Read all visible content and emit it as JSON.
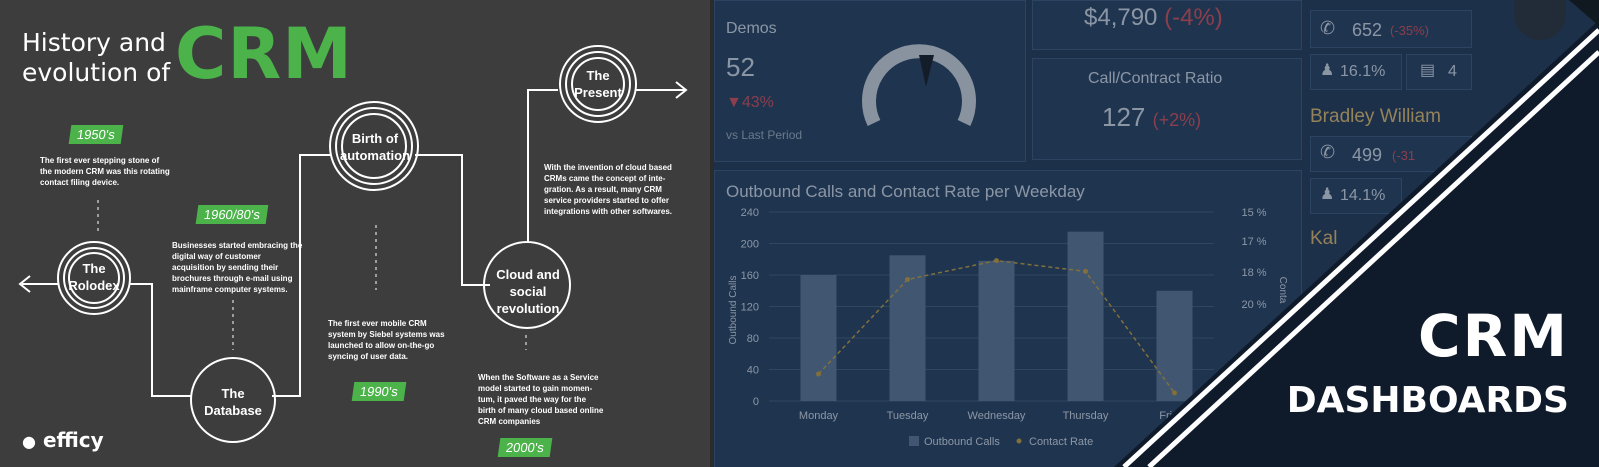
{
  "left": {
    "title_line1": "History and",
    "title_line2": "evolution of",
    "title_big": "CRM",
    "brand": "efficy",
    "eras": [
      {
        "tag": "1950's",
        "note": "The first ever stepping stone of the modern CRM was this rotating contact filing device.",
        "circle": "The Rolodex"
      },
      {
        "tag": "1960/80's",
        "note": "Businesses started embracing the digital way of customer acquisition by sending their brochures through e-mail using mainframe computer systems.",
        "circle": "The Database"
      },
      {
        "tag": "1990's",
        "note": "The first ever mobile CRM system by Siebel systems was launched to allow on-the-go syncing of user data.",
        "circle": "Birth of automation"
      },
      {
        "tag": "2000's",
        "note": "When the Software as a Service model started to gain momen-tum, it paved the way for the birth of many cloud based online CRM companies",
        "circle": "Cloud and social revolution"
      },
      {
        "tag": "",
        "note": "With the invention of cloud based CRMs came the concept of inte-gration. As a result, many CRM service providers started to offer integrations with other softwares.",
        "circle": "The Present"
      }
    ]
  },
  "right": {
    "demos_label": "Demos",
    "demos_value": "52",
    "demos_change": "▼43%",
    "vs_last": "vs Last Period",
    "revenue": "$4,790",
    "revenue_change": "(-4%)",
    "ratio_label": "Call/Contract Ratio",
    "ratio_value": "127",
    "ratio_change": "(+2%)",
    "agent1_calls": "652",
    "agent1_change": "(-35%)",
    "agent1_rate": "16.1%",
    "agent1_count": "4",
    "agent2_name": "Bradley William",
    "agent2_calls": "499",
    "agent2_change": "(-31",
    "agent2_rate": "14.1%",
    "agent3_name": "Kal",
    "overlay_title1": "CRM",
    "overlay_title2": "DASHBOARDS",
    "accent_green": "#4bb34a",
    "accent_red": "#c84a55"
  },
  "chart_data": {
    "type": "bar",
    "title": "Outbound Calls and Contact Rate per Weekday",
    "categories": [
      "Monday",
      "Tuesday",
      "Wednesday",
      "Thursday",
      "Friday"
    ],
    "series": [
      {
        "name": "Outbound Calls",
        "type": "bar",
        "values": [
          160,
          185,
          178,
          215,
          140
        ]
      },
      {
        "name": "Contact Rate",
        "type": "line",
        "values": [
          14.0,
          17.5,
          18.2,
          17.8,
          13.3
        ]
      }
    ],
    "ylabel": "Outbound Calls",
    "ylabel_right": "Conta",
    "ylim": [
      0,
      240
    ],
    "yticks": [
      "0",
      "40",
      "80",
      "120",
      "160",
      "200",
      "240"
    ],
    "y2ticks": [
      "15 %",
      "17 %",
      "18 %",
      "20 %"
    ],
    "legend": [
      "Outbound Calls",
      "Contact Rate"
    ],
    "legend_position": "bottom"
  }
}
